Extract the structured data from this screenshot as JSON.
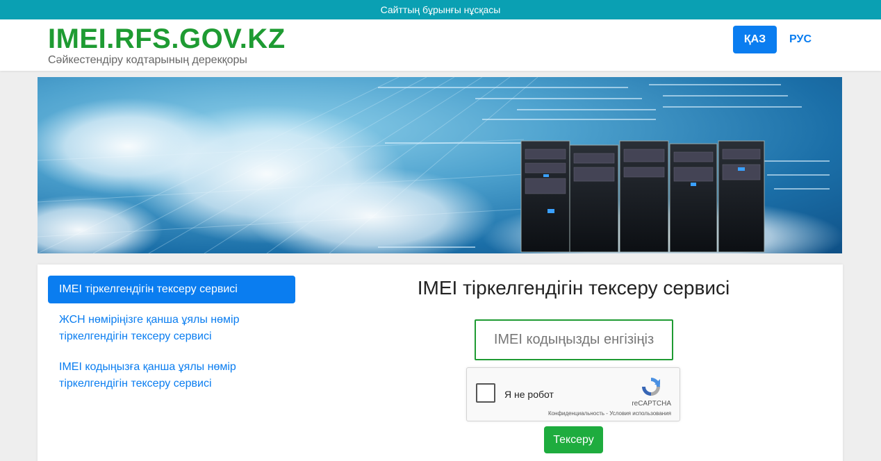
{
  "topbar": {
    "old_version_link": "Сайттың бұрынғы нұсқасы"
  },
  "header": {
    "logo_title": "IMEI.RFS.GOV.KZ",
    "logo_subtitle": "Сәйкестендіру кодтарының дерекқоры",
    "lang_kz": "ҚАЗ",
    "lang_ru": "РУС"
  },
  "sidebar": {
    "items": [
      {
        "label": "IMEI тіркелгендігін тексеру сервисі",
        "active": true
      },
      {
        "label": "ЖСН нөміріңізге қанша ұялы нөмір тіркелгендігін тексеру сервисі",
        "active": false
      },
      {
        "label": "IMEI кодыңызға қанша ұялы нөмір тіркелгендігін тексеру сервисі",
        "active": false
      }
    ]
  },
  "main": {
    "title": "IMEI тіркелгендігін тексеру сервисі",
    "imei_placeholder": "IMEI кодыңызды енгізіңіз",
    "submit_label": "Тексеру"
  },
  "recaptcha": {
    "label": "Я не робот",
    "brand": "reCAPTCHA",
    "terms": "Конфиденциальность - Условия использования"
  },
  "colors": {
    "topbar": "#0aa0b3",
    "logo_green": "#1e9b32",
    "accent_blue": "#0a7df0",
    "submit_green": "#1eac3e"
  }
}
